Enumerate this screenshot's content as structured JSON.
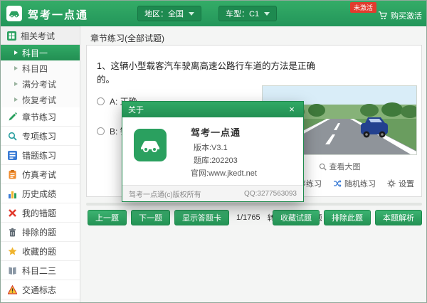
{
  "header": {
    "app_title": "驾考一点通",
    "region_label": "地区：全国",
    "cartype_label": "车型：C1",
    "activation_badge": "未激活",
    "buy_activation": "购买激活"
  },
  "sidebar": {
    "section": {
      "label": "相关考试"
    },
    "subs": [
      {
        "label": "科目一"
      },
      {
        "label": "科目四"
      },
      {
        "label": "满分考试"
      },
      {
        "label": "恢复考试"
      }
    ],
    "items": [
      {
        "label": "章节练习"
      },
      {
        "label": "专项练习"
      },
      {
        "label": "错题练习"
      },
      {
        "label": "仿真考试"
      },
      {
        "label": "历史成绩"
      },
      {
        "label": "我的错题"
      },
      {
        "label": "排除的题"
      },
      {
        "label": "收藏的题"
      },
      {
        "label": "科目二三"
      },
      {
        "label": "交通标志"
      }
    ]
  },
  "main": {
    "section_title": "章节练习(全部试题)",
    "question": {
      "text": "1、这辆小型载客汽车驶离高速公路行车道的方法是正确的。",
      "options": [
        {
          "label": "A: 正确"
        },
        {
          "label": "B: 错误"
        }
      ]
    },
    "image_caption": "查看大图",
    "modes": {
      "sequential": "顺序练习",
      "random": "随机练习",
      "settings": "设置"
    },
    "pager": {
      "prev": "上一题",
      "next": "下一题",
      "answer_card": "显示答题卡",
      "progress": "1/1765",
      "goto_label": "转到",
      "goto_suffix": "题"
    },
    "actions": {
      "favorite": "收藏试题",
      "exclude": "排除此题",
      "analysis": "本题解析"
    }
  },
  "dialog": {
    "title": "关于",
    "close_glyph": "×",
    "app_name": "驾考一点通",
    "version": "版本:V3.1",
    "bank": "题库:202203",
    "site": "官网:www.jkedt.net",
    "copyright": "驾考一点通(c)版权所有",
    "qq": "QQ:3277563093"
  },
  "colors": {
    "accent_green": "#2aa05f",
    "dark_green": "#1d8a4c",
    "badge_red": "#e23b2e"
  }
}
